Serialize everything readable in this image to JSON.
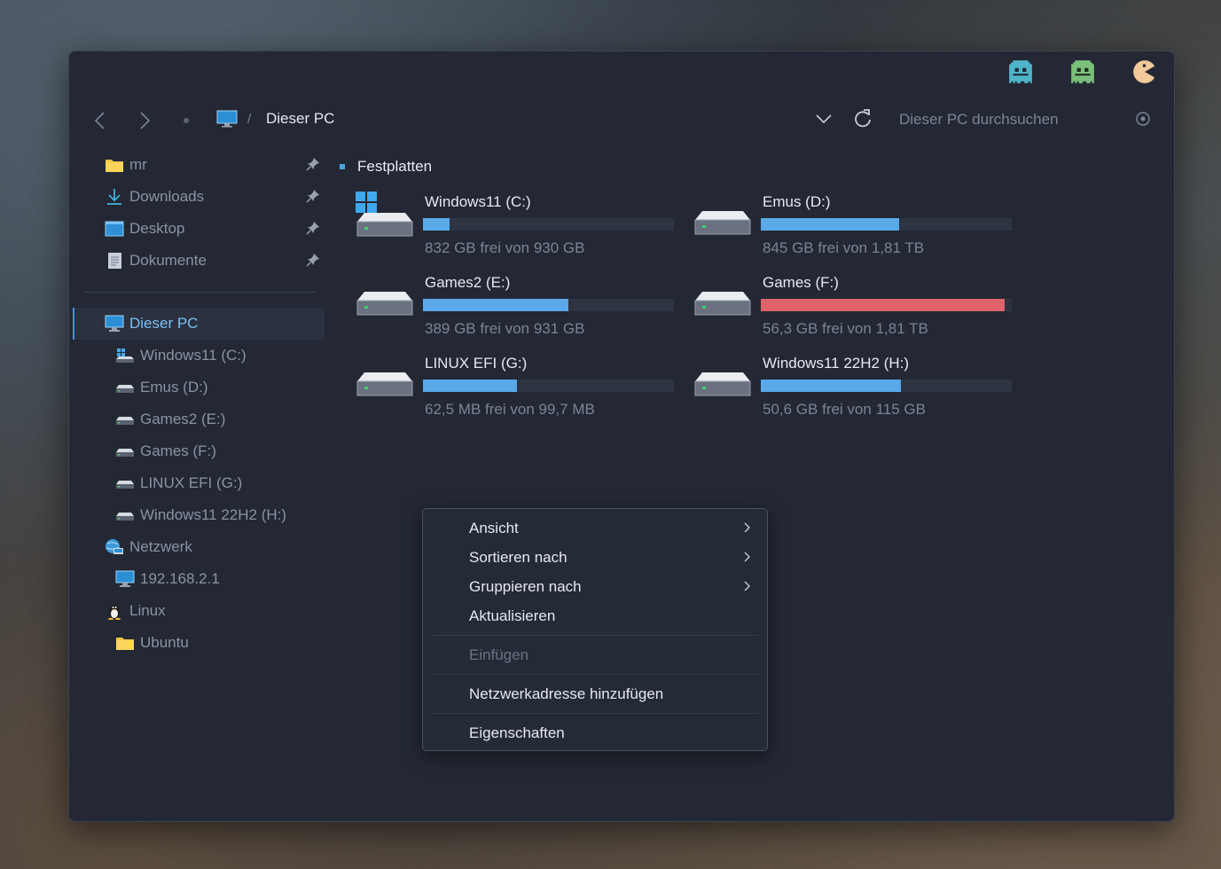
{
  "window": {
    "title": "Dieser PC"
  },
  "titlebar": {
    "sprites": [
      "ghost-cyan-icon",
      "ghost-green-icon",
      "pacman-icon"
    ]
  },
  "navigation": {
    "back_icon": "chevron-left-icon",
    "forward_icon": "chevron-right-icon",
    "breadcrumb": {
      "separator": "/",
      "current": "Dieser PC"
    },
    "search": {
      "placeholder": "Dieser PC durchsuchen"
    }
  },
  "sidebar": {
    "quick_access": [
      {
        "label": "mr",
        "icon": "folder-icon",
        "pinned": false
      },
      {
        "label": "Downloads",
        "icon": "download-icon",
        "pinned": true
      },
      {
        "label": "Desktop",
        "icon": "desktop-icon",
        "pinned": true
      },
      {
        "label": "Dokumente",
        "icon": "document-icon",
        "pinned": true
      }
    ],
    "this_pc": {
      "label": "Dieser PC",
      "icon": "computer-icon"
    },
    "drives": [
      {
        "label": "Windows11 (C:)"
      },
      {
        "label": "Emus (D:)"
      },
      {
        "label": "Games2 (E:)"
      },
      {
        "label": "Games (F:)"
      },
      {
        "label": "LINUX EFI (G:)"
      },
      {
        "label": "Windows11 22H2 (H:)"
      }
    ],
    "network": {
      "label": "Netzwerk",
      "child": "192.168.2.1"
    },
    "linux": {
      "label": "Linux",
      "child": "Ubuntu"
    }
  },
  "content": {
    "section_title": "Festplatten",
    "drives": [
      {
        "name": "Windows11 (C:)",
        "free_text": "832 GB frei von 930 GB",
        "used_fraction": 0.106,
        "icon": "windows-drive-icon"
      },
      {
        "name": "Emus (D:)",
        "free_text": "845 GB frei von 1,81 TB",
        "used_fraction": 0.55,
        "icon": "hard-drive-icon"
      },
      {
        "name": "Games2 (E:)",
        "free_text": "389 GB frei von 931 GB",
        "used_fraction": 0.58,
        "icon": "hard-drive-icon"
      },
      {
        "name": "Games (F:)",
        "free_text": "56,3 GB frei von 1,81 TB",
        "used_fraction": 0.97,
        "icon": "hard-drive-icon"
      },
      {
        "name": "LINUX EFI (G:)",
        "free_text": "62,5 MB frei von 99,7 MB",
        "used_fraction": 0.373,
        "icon": "hard-drive-icon"
      },
      {
        "name": "Windows11 22H2 (H:)",
        "free_text": "50,6 GB frei von 115 GB",
        "used_fraction": 0.56,
        "icon": "hard-drive-icon"
      }
    ]
  },
  "context_menu": {
    "items": [
      {
        "label": "Ansicht",
        "submenu": true,
        "disabled": false
      },
      {
        "label": "Sortieren nach",
        "submenu": true,
        "disabled": false
      },
      {
        "label": "Gruppieren nach",
        "submenu": true,
        "disabled": false
      },
      {
        "label": "Aktualisieren",
        "submenu": false,
        "disabled": false
      },
      {
        "label": "Einfügen",
        "submenu": false,
        "disabled": true
      },
      {
        "label": "Netzwerkadresse hinzufügen",
        "submenu": false,
        "disabled": false
      },
      {
        "label": "Eigenschaften",
        "submenu": false,
        "disabled": false
      }
    ]
  },
  "colors": {
    "window_bg": "#232834",
    "accent": "#5aa9e8",
    "bar_full": "#e0636b",
    "text_primary": "#e6e9ef",
    "text_muted": "#7b8496"
  }
}
